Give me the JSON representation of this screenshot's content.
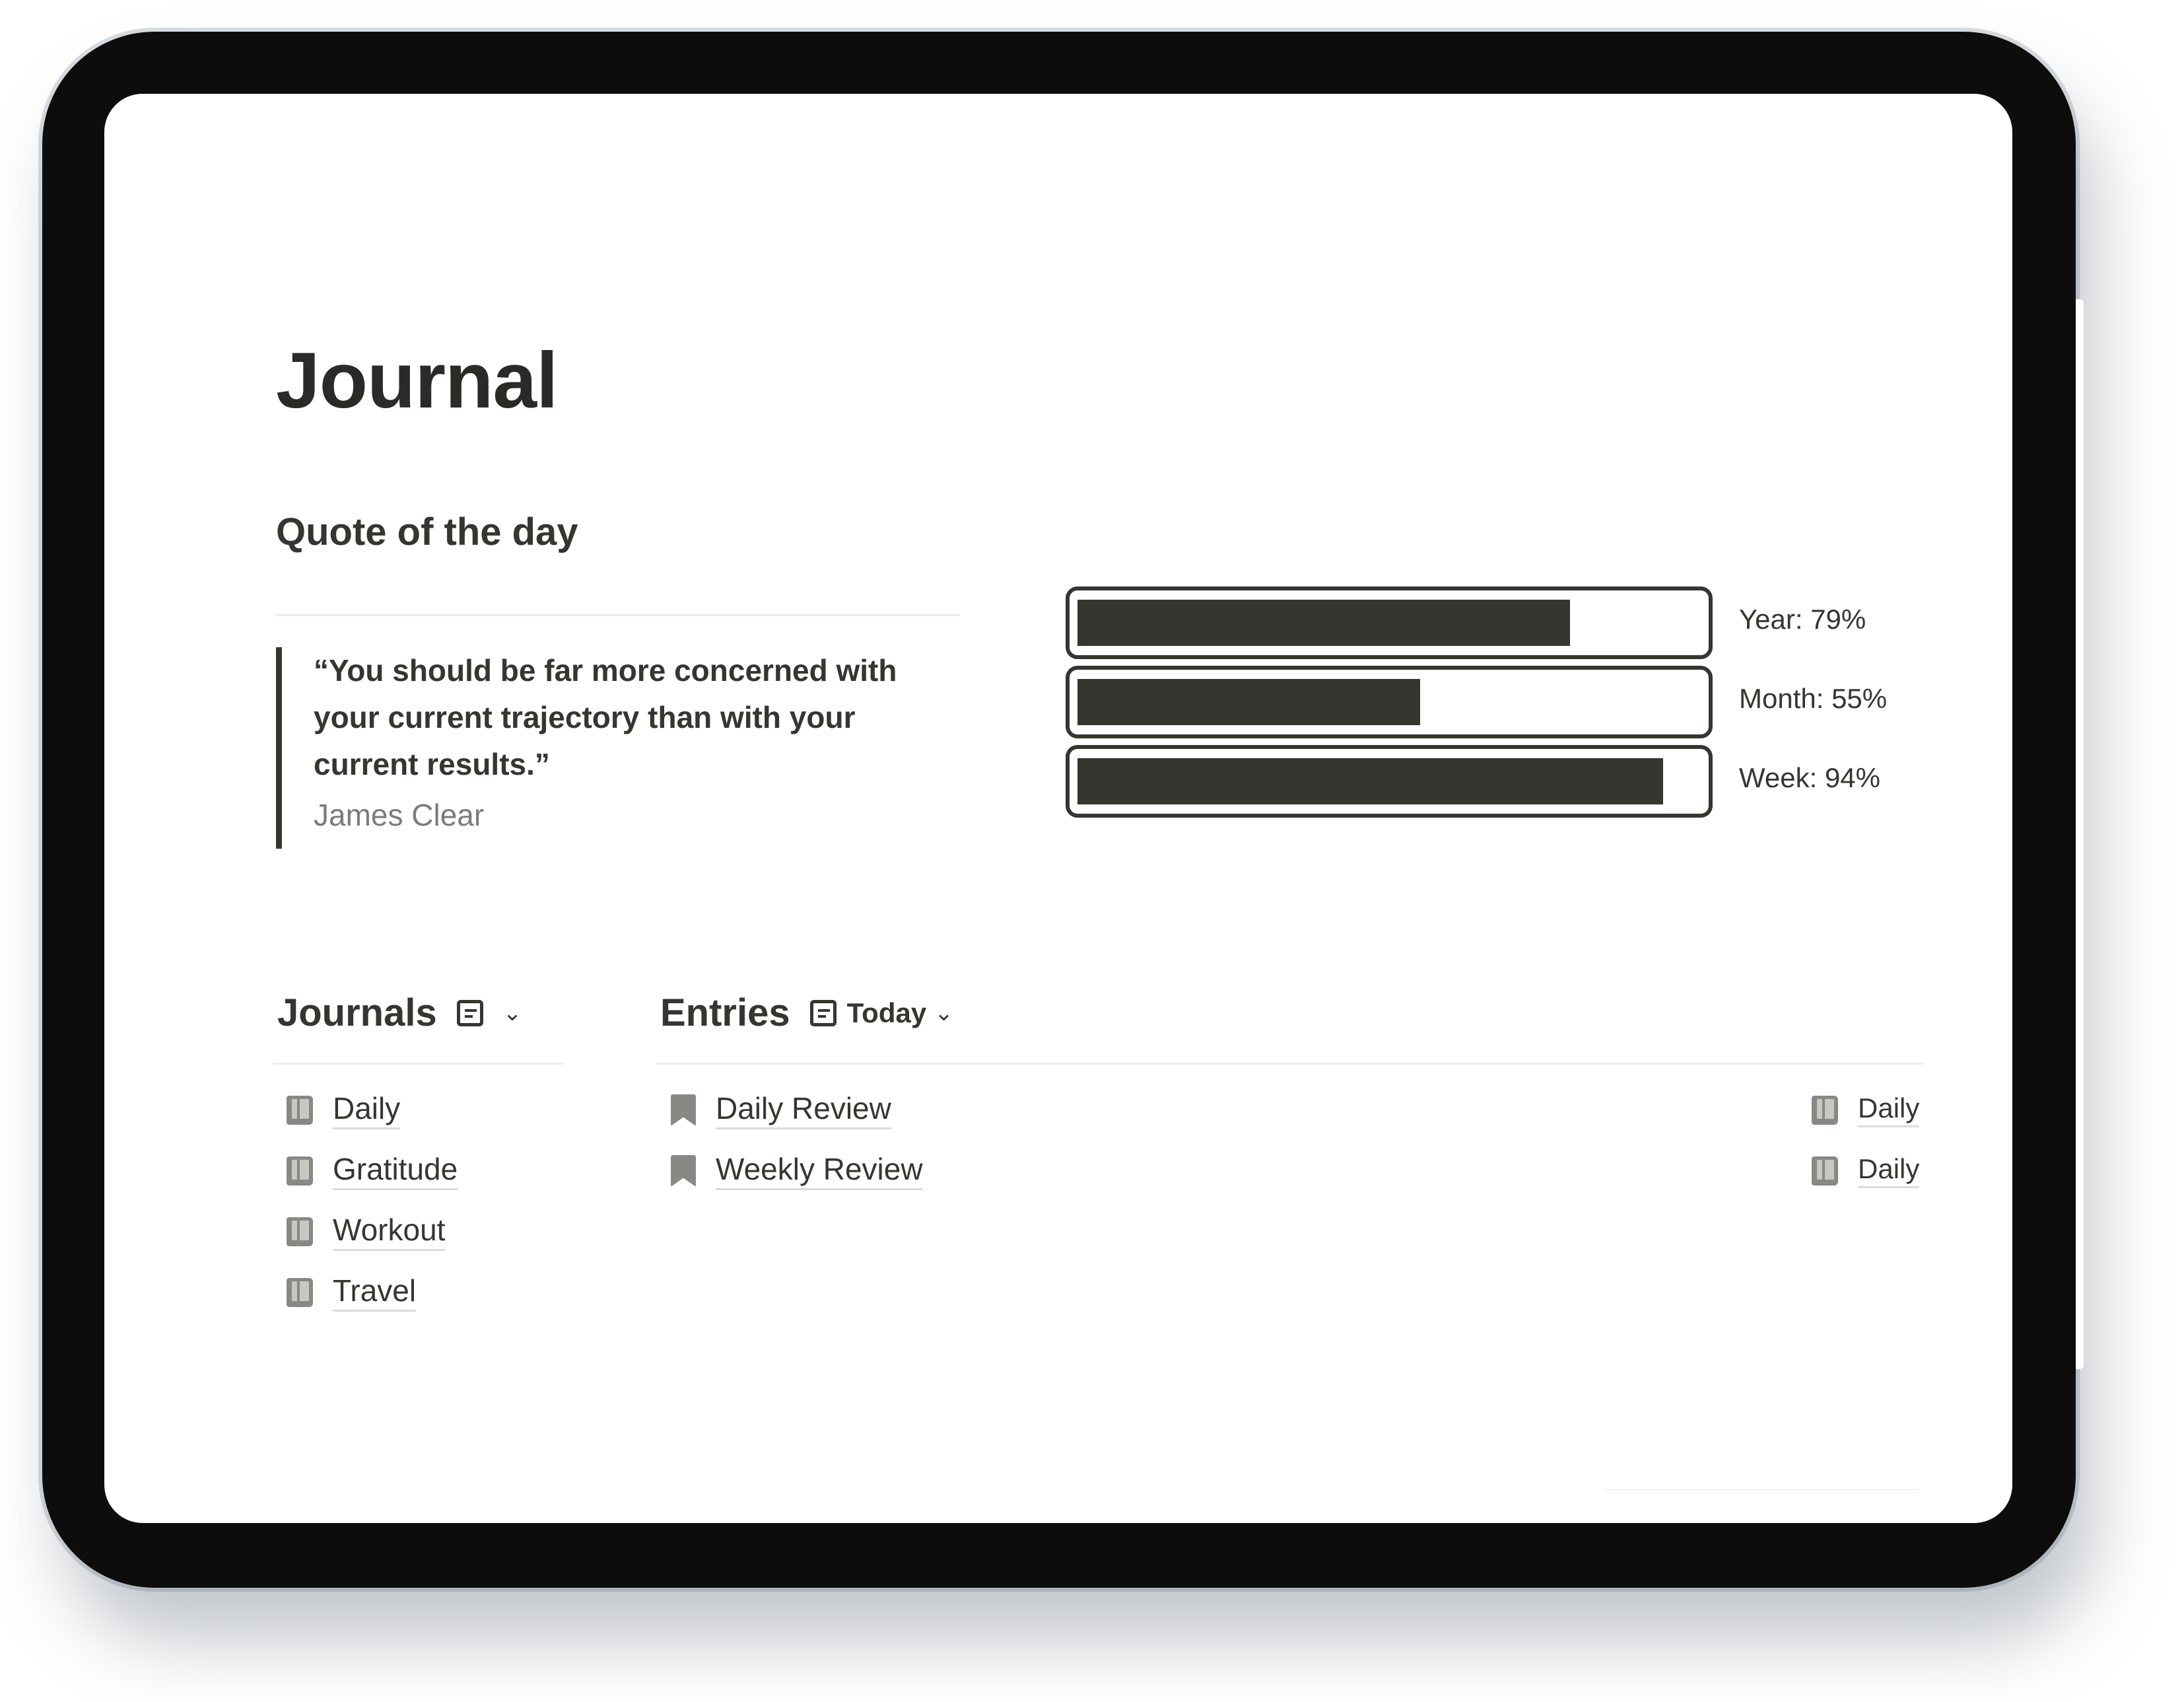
{
  "page": {
    "title": "Journal"
  },
  "quote": {
    "heading": "Quote of the day",
    "text": "“You should be far more concerned with your current trajectory than with your current results.”",
    "author": "James Clear"
  },
  "progress": [
    {
      "label": "Year: 79%",
      "value": 0.79
    },
    {
      "label": "Month: 55%",
      "value": 0.55
    },
    {
      "label": "Week: 94%",
      "value": 0.94
    }
  ],
  "journals": {
    "title": "Journals",
    "view_icon": "list-view-icon",
    "items": [
      {
        "label": "Daily",
        "icon": "book-icon"
      },
      {
        "label": "Gratitude",
        "icon": "book-icon"
      },
      {
        "label": "Workout",
        "icon": "book-icon"
      },
      {
        "label": "Travel",
        "icon": "book-icon"
      }
    ]
  },
  "entries": {
    "title": "Entries",
    "view_icon": "list-view-icon",
    "view_name": "Today",
    "items": [
      {
        "label": "Daily Review",
        "icon": "bookmark-icon",
        "journal": "Daily"
      },
      {
        "label": "Weekly Review",
        "icon": "bookmark-icon",
        "journal": "Daily"
      }
    ]
  },
  "colors": {
    "text": "#37352f",
    "bar": "#37352f",
    "muted": "#7d7b77",
    "icon": "#8a8884",
    "bezel": "#0d0d0d"
  }
}
